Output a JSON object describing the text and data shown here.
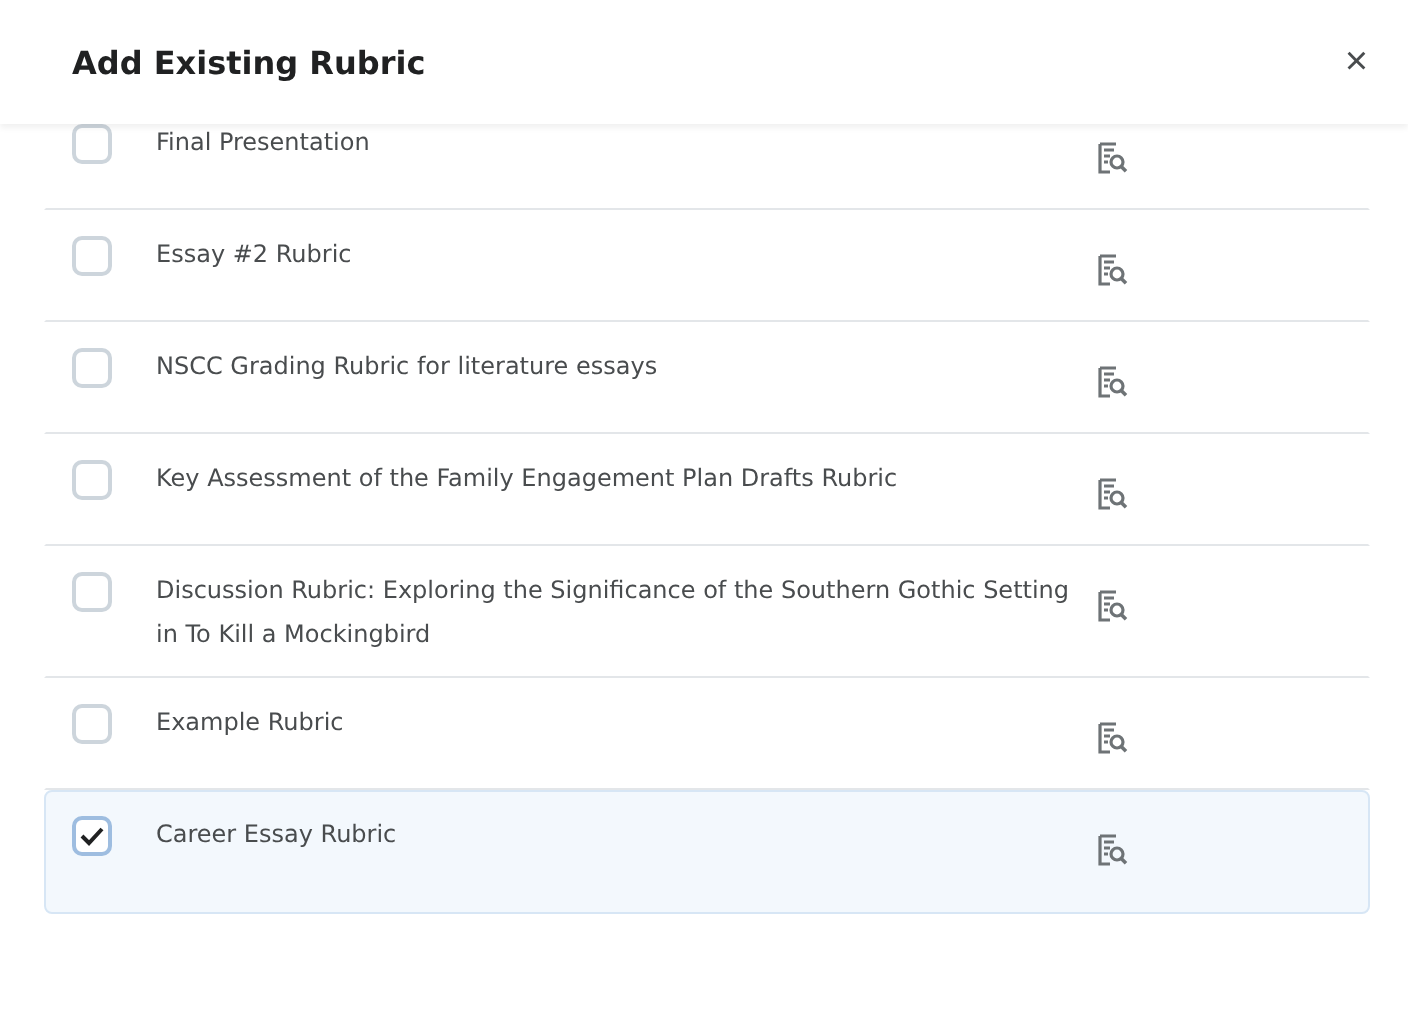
{
  "dialog": {
    "title": "Add Existing Rubric",
    "close": "×"
  },
  "rubrics": [
    {
      "name": "Final Presentation",
      "checked": false
    },
    {
      "name": "Essay #2 Rubric",
      "checked": false
    },
    {
      "name": "NSCC Grading Rubric for literature essays",
      "checked": false
    },
    {
      "name": "Key Assessment of the Family Engagement Plan Drafts Rubric",
      "checked": false
    },
    {
      "name": "Discussion Rubric: Exploring the Significance of the Southern Gothic Setting in To Kill a Mockingbird",
      "checked": false
    },
    {
      "name": "Example Rubric",
      "checked": false
    },
    {
      "name": "Career Essay Rubric",
      "checked": true
    }
  ]
}
